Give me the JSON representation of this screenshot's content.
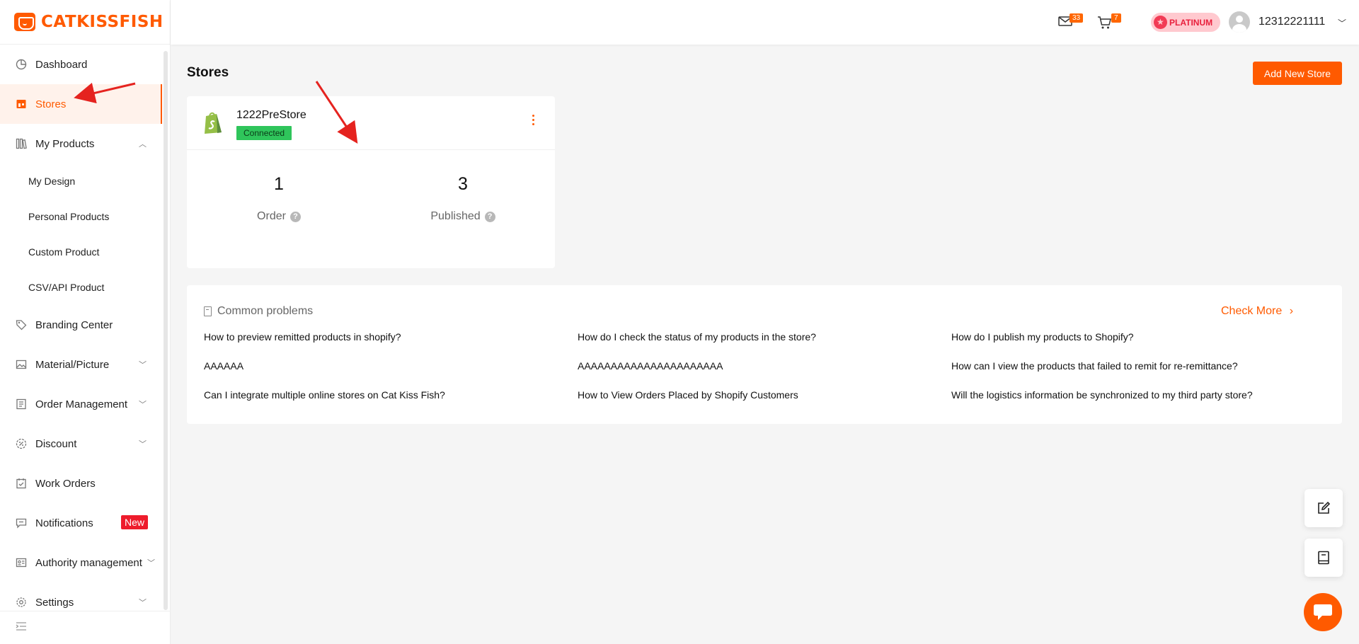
{
  "brand": {
    "name": "CATKISSFISH",
    "color": "#ff5a00"
  },
  "sidebar": {
    "items": [
      {
        "label": "Dashboard",
        "icon": "dashboard-icon"
      },
      {
        "label": "Stores",
        "icon": "store-icon",
        "active": true
      },
      {
        "label": "My Products",
        "icon": "products-icon",
        "expanded": true,
        "children": [
          "My Design",
          "Personal Products",
          "Custom Product",
          "CSV/API Product"
        ]
      },
      {
        "label": "Branding Center",
        "icon": "tag-icon"
      },
      {
        "label": "Material/Picture",
        "icon": "picture-icon"
      },
      {
        "label": "Order Management",
        "icon": "order-icon"
      },
      {
        "label": "Discount",
        "icon": "discount-icon"
      },
      {
        "label": "Work Orders",
        "icon": "work-order-icon"
      },
      {
        "label": "Notifications",
        "icon": "notification-icon",
        "badge": "New"
      },
      {
        "label": "Authority management",
        "icon": "authority-icon"
      },
      {
        "label": "Settings",
        "icon": "settings-icon"
      }
    ]
  },
  "header": {
    "mail_count": "33",
    "cart_count": "7",
    "tier": "PLATINUM",
    "username": "12312221111"
  },
  "page": {
    "title": "Stores",
    "add_button": "Add New Store"
  },
  "store": {
    "name": "1222PreStore",
    "status": "Connected",
    "order_value": "1",
    "order_label": "Order",
    "published_value": "3",
    "published_label": "Published"
  },
  "problems": {
    "title": "Common problems",
    "check_more": "Check More",
    "questions": [
      "How to preview remitted products in shopify?",
      "How do I check the status of my products in the store?",
      "How do I publish my products to Shopify?",
      "AAAAAA",
      "AAAAAAAAAAAAAAAAAAAAAA",
      "How can I view the products that failed to remit for re-remittance?",
      "Can I integrate multiple online stores on Cat Kiss Fish?",
      "How to View Orders Placed by Shopify Customers",
      "Will the logistics information be synchronized to my third party store?"
    ]
  }
}
